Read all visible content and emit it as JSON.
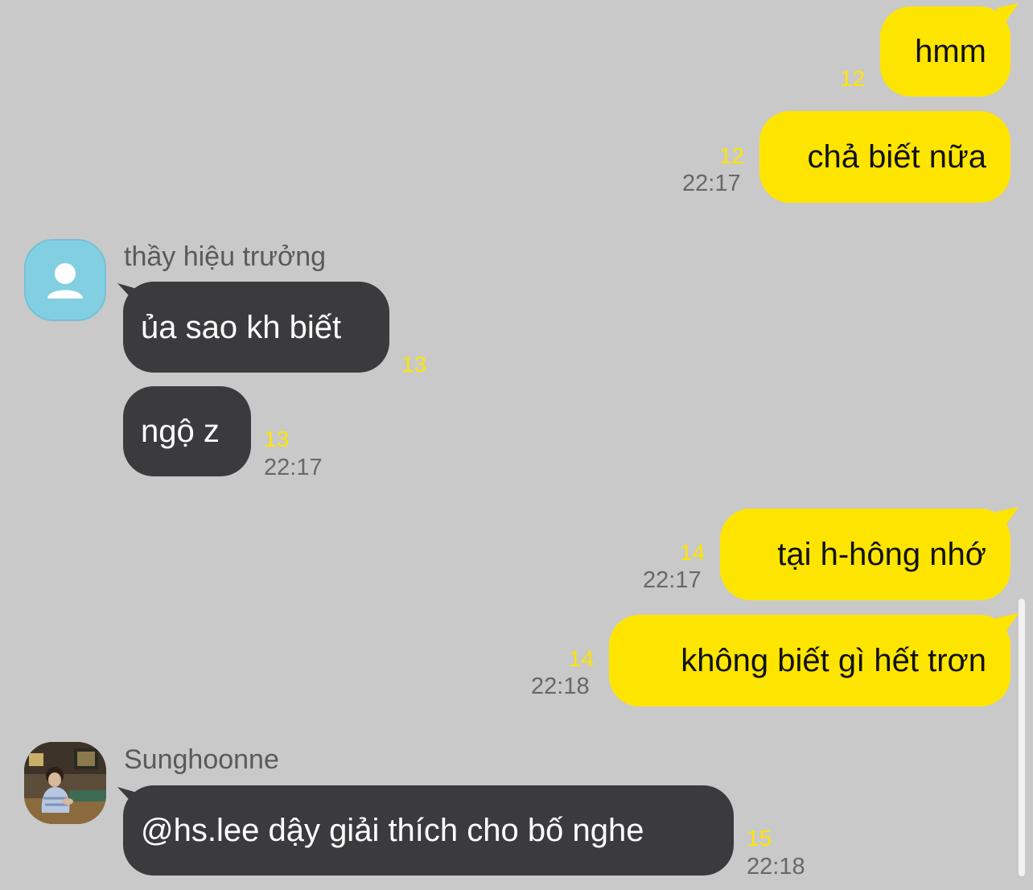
{
  "colors": {
    "background": "#c9c9c9",
    "outgoing_bubble": "#fee500",
    "incoming_bubble": "#3b3b3e",
    "unread_count": "#fee500",
    "timestamp": "#686868"
  },
  "messages": [
    {
      "direction": "outgoing",
      "text": "hmm",
      "unread": "12",
      "time": ""
    },
    {
      "direction": "outgoing",
      "text": "chả biết nữa",
      "unread": "12",
      "time": "22:17"
    },
    {
      "direction": "incoming",
      "sender": "thầy hiệu trưởng",
      "avatar": "default-person-icon",
      "text": "ủa sao kh biết",
      "unread": "13",
      "time": ""
    },
    {
      "direction": "incoming",
      "text": "ngộ z",
      "unread": "13",
      "time": "22:17"
    },
    {
      "direction": "outgoing",
      "text": "tại h-hông nhớ",
      "unread": "14",
      "time": "22:17"
    },
    {
      "direction": "outgoing",
      "text": "không biết gì hết trơn",
      "unread": "14",
      "time": "22:18"
    },
    {
      "direction": "incoming",
      "sender": "Sunghoonne",
      "avatar": "profile-photo",
      "text": "@hs.lee dậy giải thích cho bố nghe",
      "unread": "15",
      "time": "22:18"
    }
  ]
}
